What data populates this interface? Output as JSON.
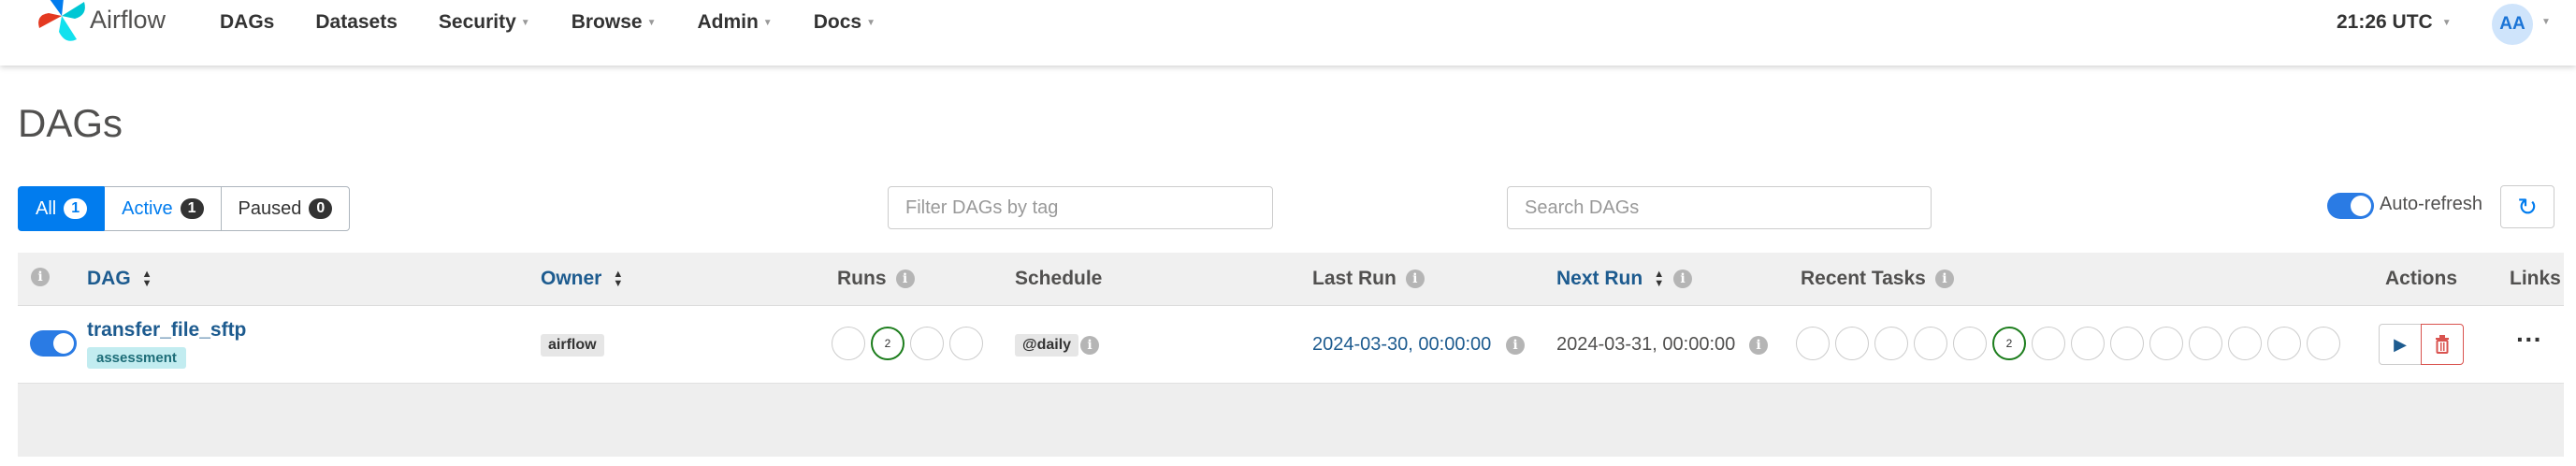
{
  "navbar": {
    "brand": "Airflow",
    "items": [
      "DAGs",
      "Datasets",
      "Security",
      "Browse",
      "Admin",
      "Docs"
    ],
    "time": "21:26 UTC",
    "avatar": "AA"
  },
  "page": {
    "title": "DAGs"
  },
  "filters": {
    "all_label": "All",
    "all_count": "1",
    "active_label": "Active",
    "active_count": "1",
    "paused_label": "Paused",
    "paused_count": "0",
    "tag_placeholder": "Filter DAGs by tag",
    "search_placeholder": "Search DAGs",
    "auto_refresh_label": "Auto-refresh"
  },
  "table": {
    "headers": {
      "dag": "DAG",
      "owner": "Owner",
      "runs": "Runs",
      "schedule": "Schedule",
      "last_run": "Last Run",
      "next_run": "Next Run",
      "recent_tasks": "Recent Tasks",
      "actions": "Actions",
      "links": "Links"
    },
    "rows": [
      {
        "dag_id": "transfer_file_sftp",
        "tag": "assessment",
        "owner": "airflow",
        "runs_success_count": "2",
        "schedule": "@daily",
        "last_run": "2024-03-30, 00:00:00",
        "next_run": "2024-03-31, 00:00:00",
        "recent_tasks_success_count": "2",
        "paused": false
      }
    ]
  },
  "colors": {
    "primary": "#017cee",
    "link": "#1d5b8f",
    "success": "#1c7d1c",
    "danger": "#d9534f"
  }
}
